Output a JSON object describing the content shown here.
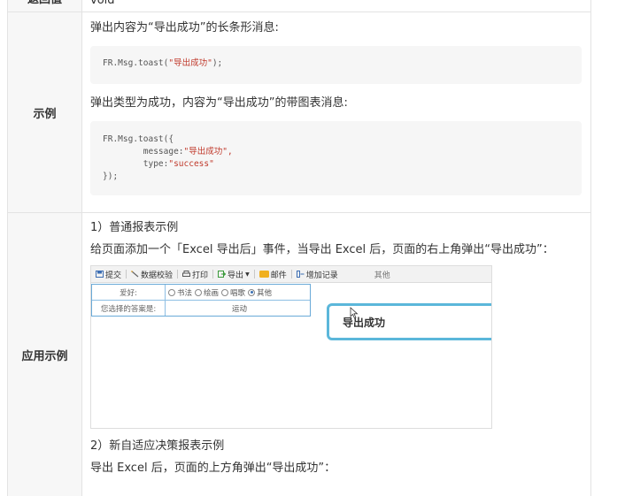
{
  "return_row": {
    "label": "返回值",
    "value": "void"
  },
  "example_row": {
    "label": "示例",
    "desc1": "弹出内容为“导出成功”的长条形消息:",
    "code1_prefix": "FR.Msg.toast(",
    "code1_string": "\"导出成功\"",
    "code1_suffix": ");",
    "desc2": "弹出类型为成功，内容为“导出成功”的带图表消息:",
    "code2_line1": "FR.Msg.toast({",
    "code2_key1": "        message:",
    "code2_val1": "\"导出成功\",",
    "code2_key2": "        type:",
    "code2_val2": "\"success\"",
    "code2_line4": "});"
  },
  "app_row": {
    "label": "应用示例",
    "item1_title": "1）普通报表示例",
    "item1_desc": "给页面添加一个「Excel 导出后」事件，当导出 Excel 后，页面的右上角弹出“导出成功”：",
    "item2_title": "2）新自适应决策报表示例",
    "item2_desc": "导出 Excel 后，页面的上方角弹出“导出成功”："
  },
  "screenshot": {
    "toolbar": {
      "submit": "提交",
      "validate": "数据校验",
      "print": "打印",
      "export": "导出",
      "mail": "邮件",
      "add_record": "增加记录",
      "other": "其他"
    },
    "form": {
      "hobby_label": "爱好:",
      "options": [
        "书法",
        "绘画",
        "唱歌",
        "其他"
      ],
      "selected_option": "其他",
      "answer_label": "您选择的答案是:",
      "answer_value": "运动"
    },
    "toast_text": "导出成功"
  },
  "colors": {
    "toast_border": "#5bb7da",
    "code_string": "#c0392b",
    "label_bg": "#f7f7f7"
  }
}
